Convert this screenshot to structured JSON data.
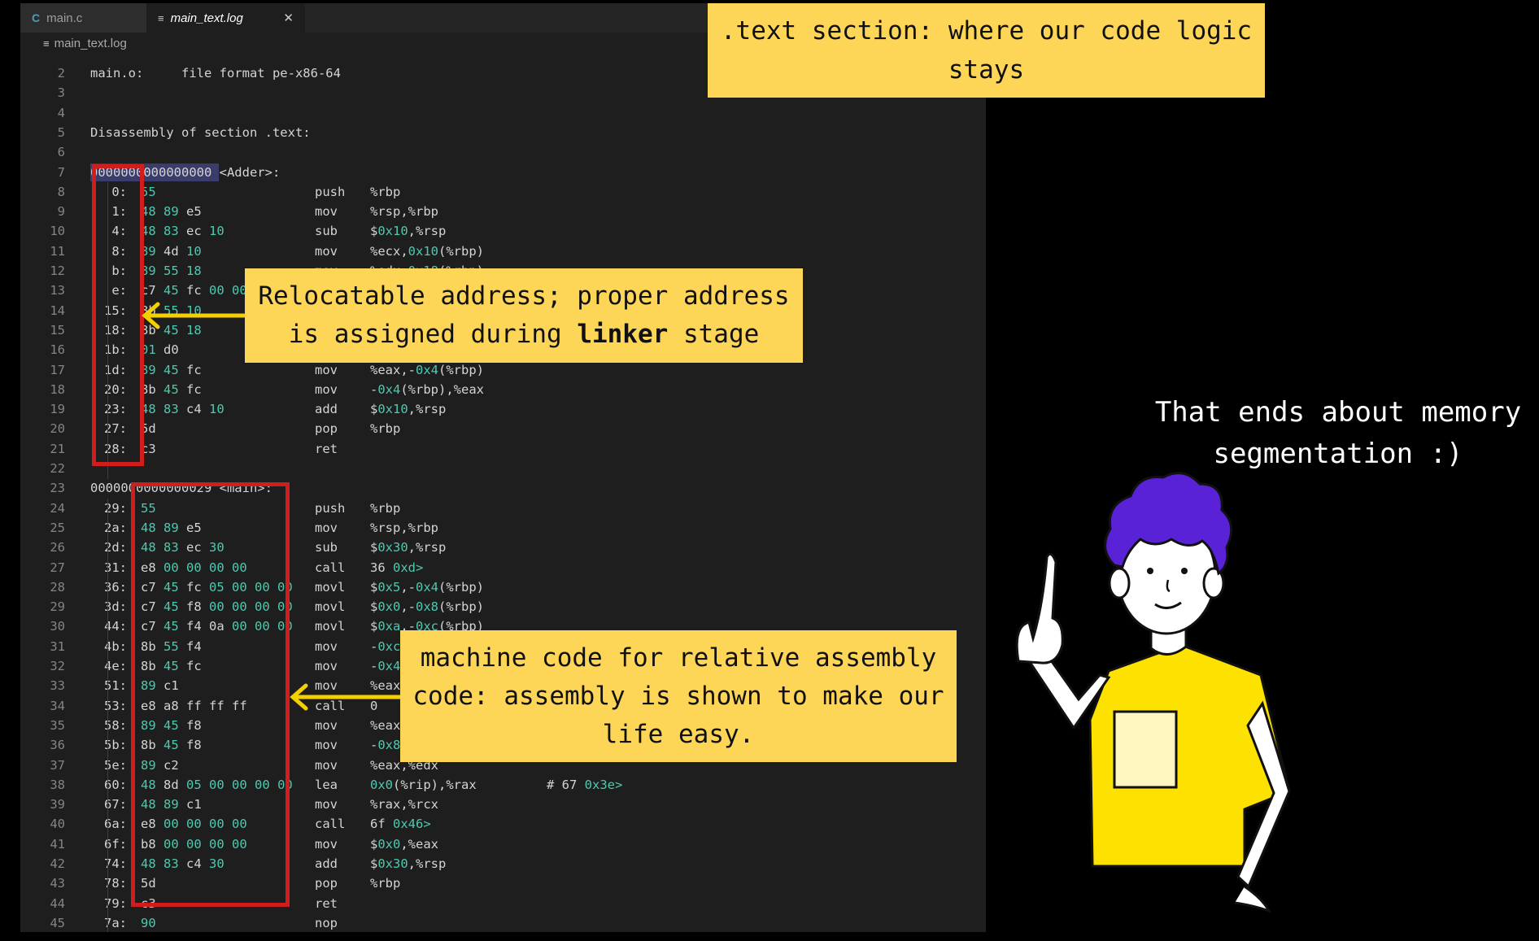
{
  "tabs": [
    {
      "label": "main.c",
      "icon": "c-file-icon",
      "active": false
    },
    {
      "label": "main_text.log",
      "icon": "text-file-icon",
      "active": true
    }
  ],
  "breadcrumb": {
    "file": "main_text.log"
  },
  "lines": [
    {
      "n": "2",
      "header": "main.o:     file format pe-x86-64"
    },
    {
      "n": "3"
    },
    {
      "n": "4"
    },
    {
      "n": "5",
      "header": "Disassembly of section .text:"
    },
    {
      "n": "6"
    },
    {
      "n": "7",
      "header": "0000000000000000 <Adder>:"
    },
    {
      "n": "8",
      "addr": "0:",
      "bytes": "55",
      "mnem": "push",
      "ops": "%rbp"
    },
    {
      "n": "9",
      "addr": "1:",
      "bytes": "48 89 e5",
      "mnem": "mov",
      "ops": "%rsp,%rbp"
    },
    {
      "n": "10",
      "addr": "4:",
      "bytes": "48 83 ec 10",
      "mnem": "sub",
      "ops": "$0x10,%rsp"
    },
    {
      "n": "11",
      "addr": "8:",
      "bytes": "89 4d 10",
      "mnem": "mov",
      "ops": "%ecx,0x10(%rbp)"
    },
    {
      "n": "12",
      "addr": "b:",
      "bytes": "89 55 18",
      "mnem": "mov",
      "ops": "%edx,0x18(%rbp)"
    },
    {
      "n": "13",
      "addr": "e:",
      "bytes": "c7 45 fc 00 00",
      "mnem": "",
      "ops": ""
    },
    {
      "n": "14",
      "addr": "15:",
      "bytes": "8b 55 10",
      "mnem": "",
      "ops": ""
    },
    {
      "n": "15",
      "addr": "18:",
      "bytes": "8b 45 18",
      "mnem": "",
      "ops": ""
    },
    {
      "n": "16",
      "addr": "1b:",
      "bytes": "01 d0",
      "mnem": "",
      "ops": ""
    },
    {
      "n": "17",
      "addr": "1d:",
      "bytes": "89 45 fc",
      "mnem": "mov",
      "ops": "%eax,-0x4(%rbp)"
    },
    {
      "n": "18",
      "addr": "20:",
      "bytes": "8b 45 fc",
      "mnem": "mov",
      "ops": "-0x4(%rbp),%eax"
    },
    {
      "n": "19",
      "addr": "23:",
      "bytes": "48 83 c4 10",
      "mnem": "add",
      "ops": "$0x10,%rsp"
    },
    {
      "n": "20",
      "addr": "27:",
      "bytes": "5d",
      "mnem": "pop",
      "ops": "%rbp"
    },
    {
      "n": "21",
      "addr": "28:",
      "bytes": "c3",
      "mnem": "ret",
      "ops": ""
    },
    {
      "n": "22"
    },
    {
      "n": "23",
      "header": "0000000000000029 <main>:"
    },
    {
      "n": "24",
      "addr": "29:",
      "bytes": "55",
      "mnem": "push",
      "ops": "%rbp"
    },
    {
      "n": "25",
      "addr": "2a:",
      "bytes": "48 89 e5",
      "mnem": "mov",
      "ops": "%rsp,%rbp"
    },
    {
      "n": "26",
      "addr": "2d:",
      "bytes": "48 83 ec 30",
      "mnem": "sub",
      "ops": "$0x30,%rsp"
    },
    {
      "n": "27",
      "addr": "31:",
      "bytes": "e8 00 00 00 00",
      "mnem": "call",
      "ops": "36 <main+0xd>"
    },
    {
      "n": "28",
      "addr": "36:",
      "bytes": "c7 45 fc 05 00 00 00",
      "mnem": "movl",
      "ops": "$0x5,-0x4(%rbp)"
    },
    {
      "n": "29",
      "addr": "3d:",
      "bytes": "c7 45 f8 00 00 00 00",
      "mnem": "movl",
      "ops": "$0x0,-0x8(%rbp)"
    },
    {
      "n": "30",
      "addr": "44:",
      "bytes": "c7 45 f4 0a 00 00 00",
      "mnem": "movl",
      "ops": "$0xa,-0xc(%rbp)"
    },
    {
      "n": "31",
      "addr": "4b:",
      "bytes": "8b 55 f4",
      "mnem": "mov",
      "ops": "-0xc"
    },
    {
      "n": "32",
      "addr": "4e:",
      "bytes": "8b 45 fc",
      "mnem": "mov",
      "ops": "-0x4"
    },
    {
      "n": "33",
      "addr": "51:",
      "bytes": "89 c1",
      "mnem": "mov",
      "ops": "%eax"
    },
    {
      "n": "34",
      "addr": "53:",
      "bytes": "e8 a8 ff ff ff",
      "mnem": "call",
      "ops": "0 <A"
    },
    {
      "n": "35",
      "addr": "58:",
      "bytes": "89 45 f8",
      "mnem": "mov",
      "ops": "%eax"
    },
    {
      "n": "36",
      "addr": "5b:",
      "bytes": "8b 45 f8",
      "mnem": "mov",
      "ops": "-0x8"
    },
    {
      "n": "37",
      "addr": "5e:",
      "bytes": "89 c2",
      "mnem": "mov",
      "ops": "%eax,%edx"
    },
    {
      "n": "38",
      "addr": "60:",
      "bytes": "48 8d 05 00 00 00 00",
      "mnem": "lea",
      "ops": "0x0(%rip),%rax",
      "comment": "# 67 <main+0x3e>"
    },
    {
      "n": "39",
      "addr": "67:",
      "bytes": "48 89 c1",
      "mnem": "mov",
      "ops": "%rax,%rcx"
    },
    {
      "n": "40",
      "addr": "6a:",
      "bytes": "e8 00 00 00 00",
      "mnem": "call",
      "ops": "6f <main+0x46>"
    },
    {
      "n": "41",
      "addr": "6f:",
      "bytes": "b8 00 00 00 00",
      "mnem": "mov",
      "ops": "$0x0,%eax"
    },
    {
      "n": "42",
      "addr": "74:",
      "bytes": "48 83 c4 30",
      "mnem": "add",
      "ops": "$0x30,%rsp"
    },
    {
      "n": "43",
      "addr": "78:",
      "bytes": "5d",
      "mnem": "pop",
      "ops": "%rbp"
    },
    {
      "n": "44",
      "addr": "79:",
      "bytes": "c3",
      "mnem": "ret",
      "ops": ""
    },
    {
      "n": "45",
      "addr": "7a:",
      "bytes": "90",
      "mnem": "nop",
      "ops": ""
    }
  ],
  "annotations": {
    "text_section": ".text section: where our code logic stays",
    "relocatable_pre": "Relocatable address; proper address is assigned during ",
    "relocatable_bold": "linker",
    "relocatable_post": " stage",
    "machine_code": "machine code for relative assembly code: assembly is shown to make our life easy."
  },
  "closing_text": "That ends about memory segmentation :)",
  "colors": {
    "editor_bg": "#1e1e1e",
    "note_bg": "#fdd658",
    "box_red": "#d21d1d",
    "arrow_yellow": "#f5d000",
    "shirt_yellow": "#fde100",
    "hair_purple": "#5a22d6",
    "number_teal": "#4ec9b0"
  }
}
